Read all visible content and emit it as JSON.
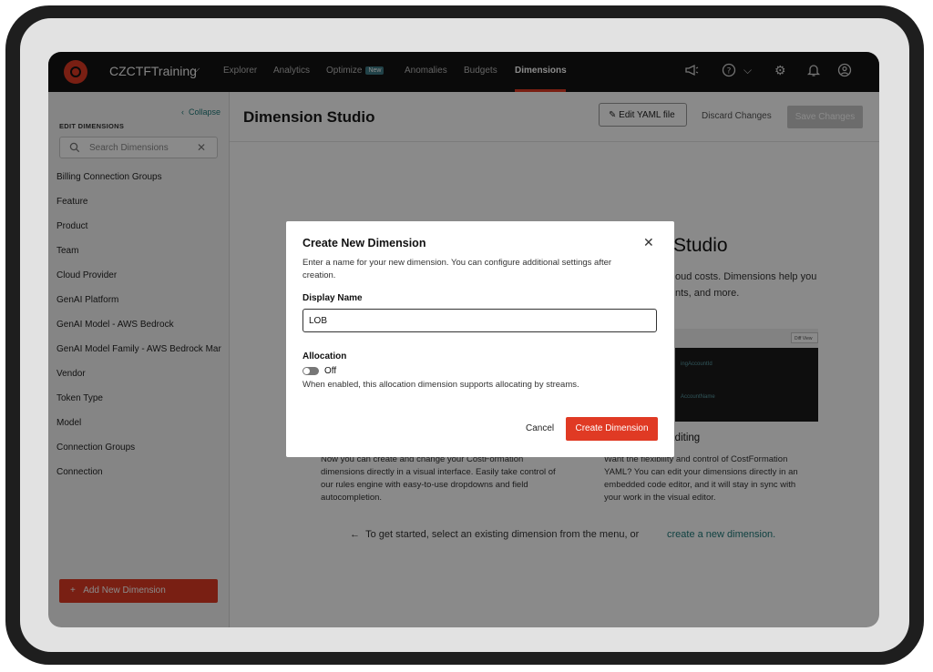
{
  "topbar": {
    "org_name": "CZCTFTraining",
    "nav": [
      {
        "label": "Explorer"
      },
      {
        "label": "Analytics"
      },
      {
        "label": "Optimize",
        "badge": "New"
      },
      {
        "label": "Anomalies"
      },
      {
        "label": "Budgets"
      },
      {
        "label": "Dimensions",
        "active": true
      }
    ],
    "icons": [
      "megaphone-icon",
      "help-icon",
      "chevron-down-icon",
      "gear-icon",
      "bell-icon",
      "user-icon"
    ]
  },
  "sidebar": {
    "collapse_label": "Collapse",
    "section_title": "EDIT DIMENSIONS",
    "search_placeholder": "Search Dimensions",
    "items": [
      {
        "label": "Billing Connection Groups"
      },
      {
        "label": "Feature"
      },
      {
        "label": "Product"
      },
      {
        "label": "Team"
      },
      {
        "label": "Cloud Provider"
      },
      {
        "label": "GenAI Platform"
      },
      {
        "label": "GenAI Model - AWS Bedrock"
      },
      {
        "label": "GenAI Model Family - AWS Bedrock Mar"
      },
      {
        "label": "Vendor"
      },
      {
        "label": "Token Type"
      },
      {
        "label": "Model"
      },
      {
        "label": "Connection Groups"
      },
      {
        "label": "Connection"
      }
    ],
    "add_button": "Add New Dimension"
  },
  "header": {
    "title": "Dimension Studio",
    "edit_yaml": "Edit YAML file",
    "discard": "Discard Changes",
    "save": "Save Changes"
  },
  "main": {
    "welcome_title_visible": "Studio",
    "welcome_line1": "oud costs. Dimensions help you",
    "welcome_line2": "nts, and more.",
    "preview_chip": "Diff View",
    "preview_lines": [
      "ingAccountId",
      "AccountName"
    ],
    "feature_right_title_visible": "Editing",
    "feature_left_lines": [
      "Now you can create and change your CostFormation",
      "dimensions directly in a visual interface. Easily take control of",
      "our rules engine with easy-to-use dropdowns and field",
      "autocompletion."
    ],
    "feature_right_lines": [
      "Want the flexibility and control of CostFormation",
      "YAML? You can edit your dimensions directly in an",
      "embedded code editor, and it will stay in sync with",
      "your work in the visual editor."
    ],
    "get_started": "To get started, select an existing dimension from the menu, or",
    "get_started_link": "create a new dimension."
  },
  "modal": {
    "title": "Create New Dimension",
    "description_line1": "Enter a name for your new dimension. You can configure additional settings after",
    "description_line2": "creation.",
    "display_name_label": "Display Name",
    "display_name_value": "LOB",
    "allocation_label": "Allocation",
    "allocation_state": "Off",
    "allocation_help": "When enabled, this allocation dimension supports allocating by streams.",
    "cancel": "Cancel",
    "create": "Create Dimension"
  },
  "colors": {
    "brand": "#e03a24",
    "link": "#1f7a7a",
    "topbar": "#141414"
  }
}
